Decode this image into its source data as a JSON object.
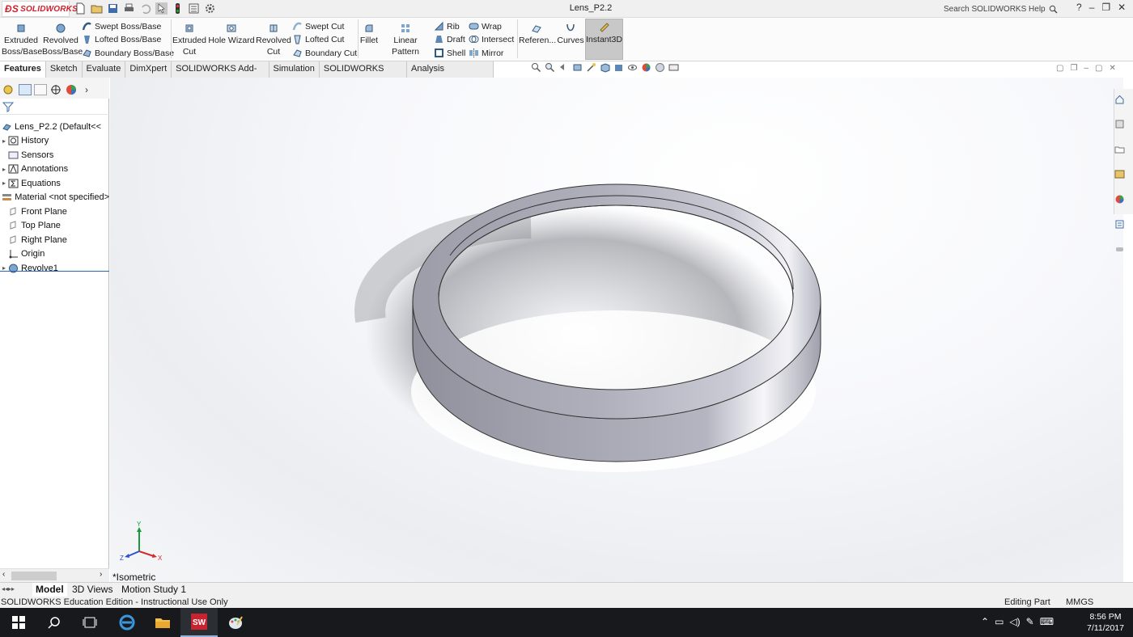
{
  "app": {
    "logo": "SOLIDWORKS",
    "title": "Lens_P2.2",
    "search_placeholder": "Search SOLIDWORKS Help"
  },
  "ribbon": {
    "extruded_boss": "Extruded Boss/Base",
    "revolved_boss": "Revolved Boss/Base",
    "swept_boss": "Swept Boss/Base",
    "lofted_boss": "Lofted Boss/Base",
    "boundary_boss": "Boundary Boss/Base",
    "extruded_cut": "Extruded Cut",
    "hole_wizard": "Hole Wizard",
    "revolved_cut": "Revolved Cut",
    "swept_cut": "Swept Cut",
    "lofted_cut": "Lofted Cut",
    "boundary_cut": "Boundary Cut",
    "fillet": "Fillet",
    "linear_pattern": "Linear Pattern",
    "rib": "Rib",
    "draft": "Draft",
    "shell": "Shell",
    "wrap": "Wrap",
    "intersect": "Intersect",
    "mirror": "Mirror",
    "reference": "Referen...",
    "curves": "Curves",
    "instant3d": "Instant3D"
  },
  "tabs": [
    "Features",
    "Sketch",
    "Evaluate",
    "DimXpert",
    "SOLIDWORKS Add-Ins",
    "Simulation",
    "SOLIDWORKS MBD",
    "Analysis Preparation"
  ],
  "tree": {
    "root": "Lens_P2.2  (Default<<",
    "items": [
      "History",
      "Sensors",
      "Annotations",
      "Equations",
      "Material <not specified>",
      "Front Plane",
      "Top Plane",
      "Right Plane",
      "Origin",
      "Revolve1"
    ]
  },
  "viewport": {
    "view_name": "*Isometric",
    "triad_x": "X",
    "triad_y": "Y",
    "triad_z": "Z"
  },
  "bottom_tabs": [
    "Model",
    "3D Views",
    "Motion Study 1"
  ],
  "status": {
    "left": "SOLIDWORKS Education Edition - Instructional Use Only",
    "mode": "Editing Part",
    "units": "MMGS"
  },
  "clock": {
    "time": "8:56 PM",
    "date": "7/11/2017"
  },
  "colors": {
    "logo": "#d11f2b",
    "selected": "#2c67b3",
    "taskbar": "#17191d",
    "ring": "#a9aab6"
  }
}
